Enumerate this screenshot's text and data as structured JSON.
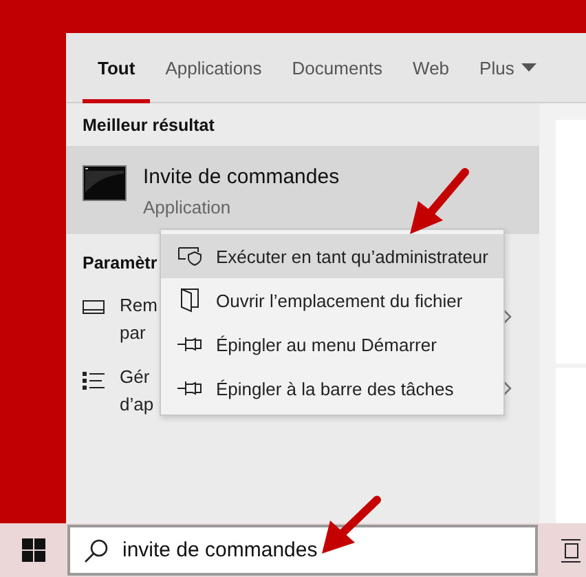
{
  "tabs": [
    {
      "label": "Tout",
      "selected": true
    },
    {
      "label": "Applications",
      "selected": false
    },
    {
      "label": "Documents",
      "selected": false
    },
    {
      "label": "Web",
      "selected": false
    },
    {
      "label": "Plus",
      "selected": false,
      "dropdown": true
    }
  ],
  "best_match": {
    "heading": "Meilleur résultat",
    "title": "Invite de commandes",
    "subtitle": "Application",
    "selected": true
  },
  "settings": {
    "heading": "Paramètr",
    "items": [
      {
        "kind": "display",
        "lines": [
          "Rem",
          "par"
        ]
      },
      {
        "kind": "list",
        "lines": [
          "Gér",
          "d’ap"
        ]
      }
    ]
  },
  "context_menu": [
    {
      "kind": "shield",
      "label": "Exécuter en tant qu’administrateur",
      "selected": true
    },
    {
      "kind": "folder",
      "label": "Ouvrir l’emplacement du fichier",
      "selected": false
    },
    {
      "kind": "pin",
      "label": "Épingler au menu Démarrer",
      "selected": false
    },
    {
      "kind": "pin",
      "label": "Épingler à la barre des tâches",
      "selected": false
    }
  ],
  "search": {
    "value": "invite de commandes"
  }
}
